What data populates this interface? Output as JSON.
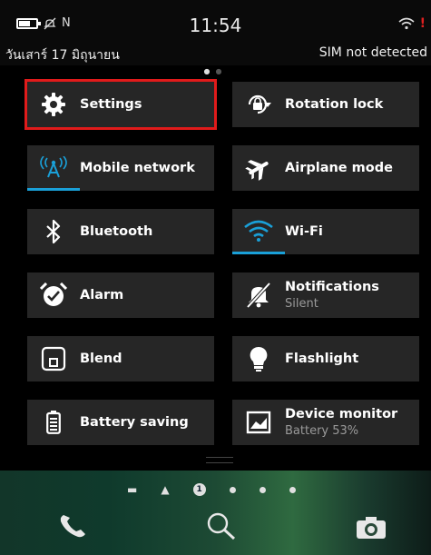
{
  "status": {
    "time": "11:54",
    "left_icons": [
      "battery-icon",
      "mute-icon",
      "nfc-icon"
    ],
    "right_icons": [
      "wifi-icon",
      "alert-icon"
    ],
    "alert_mark": "!"
  },
  "info": {
    "date": "วันเสาร์ 17 มิถุนายน",
    "sim": "SIM not detected"
  },
  "tiles": [
    {
      "label": "Settings",
      "icon": "gear-icon",
      "highlighted": true
    },
    {
      "label": "Rotation lock",
      "icon": "rotation-lock-icon"
    },
    {
      "label": "Mobile network",
      "icon": "antenna-icon",
      "active": true
    },
    {
      "label": "Airplane mode",
      "icon": "airplane-icon"
    },
    {
      "label": "Bluetooth",
      "icon": "bluetooth-icon"
    },
    {
      "label": "Wi-Fi",
      "icon": "wifi-icon",
      "active": true
    },
    {
      "label": "Alarm",
      "icon": "alarm-icon"
    },
    {
      "label": "Notifications",
      "sub": "Silent",
      "icon": "bell-muted-icon"
    },
    {
      "label": "Blend",
      "icon": "blend-icon"
    },
    {
      "label": "Flashlight",
      "icon": "bulb-icon"
    },
    {
      "label": "Battery saving",
      "icon": "battery-saving-icon"
    },
    {
      "label": "Device monitor",
      "sub": "Battery 53%",
      "icon": "device-monitor-icon"
    }
  ],
  "dock": {
    "page_indicator_number": "1",
    "apps": [
      "phone-icon",
      "search-icon",
      "camera-icon"
    ]
  },
  "colors": {
    "accent": "#1aa0d8",
    "highlight": "#e01b1b",
    "tile_bg": "#262626"
  }
}
